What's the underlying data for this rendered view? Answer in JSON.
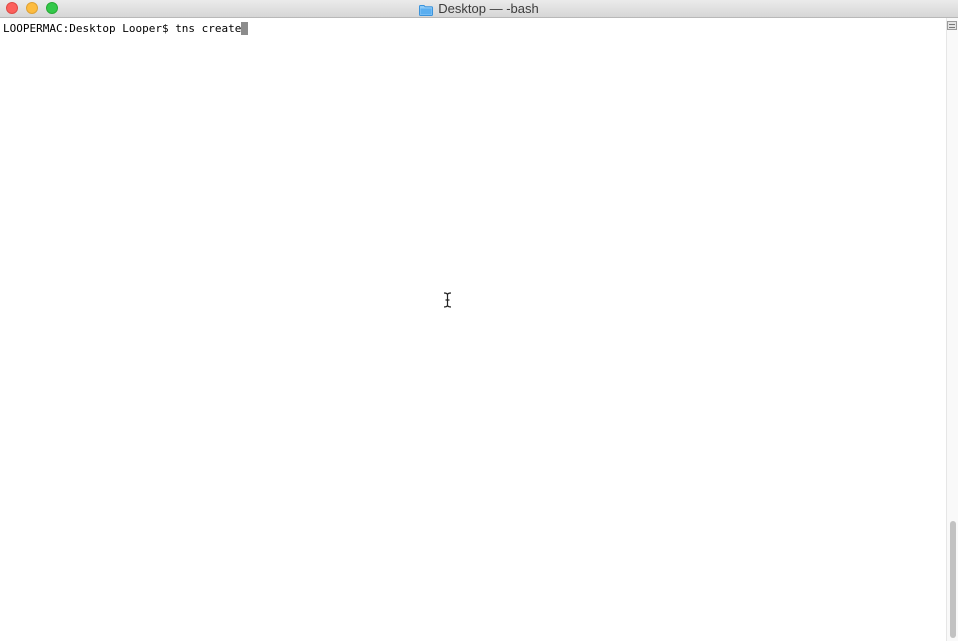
{
  "window": {
    "title": "Desktop — -bash"
  },
  "terminal": {
    "prompt": "LOOPERMAC:Desktop Looper$ ",
    "command": "tns create"
  },
  "icons": {
    "title_icon": "folder-icon",
    "mouse_cursor": "i-beam-cursor-icon"
  },
  "colors": {
    "close": "#fc605c",
    "minimize": "#fdbc40",
    "zoom": "#34c84a",
    "folder": "#5aaef0"
  },
  "scrollbar": {
    "visible_fraction": 0.19,
    "position_fraction": 1.0
  }
}
